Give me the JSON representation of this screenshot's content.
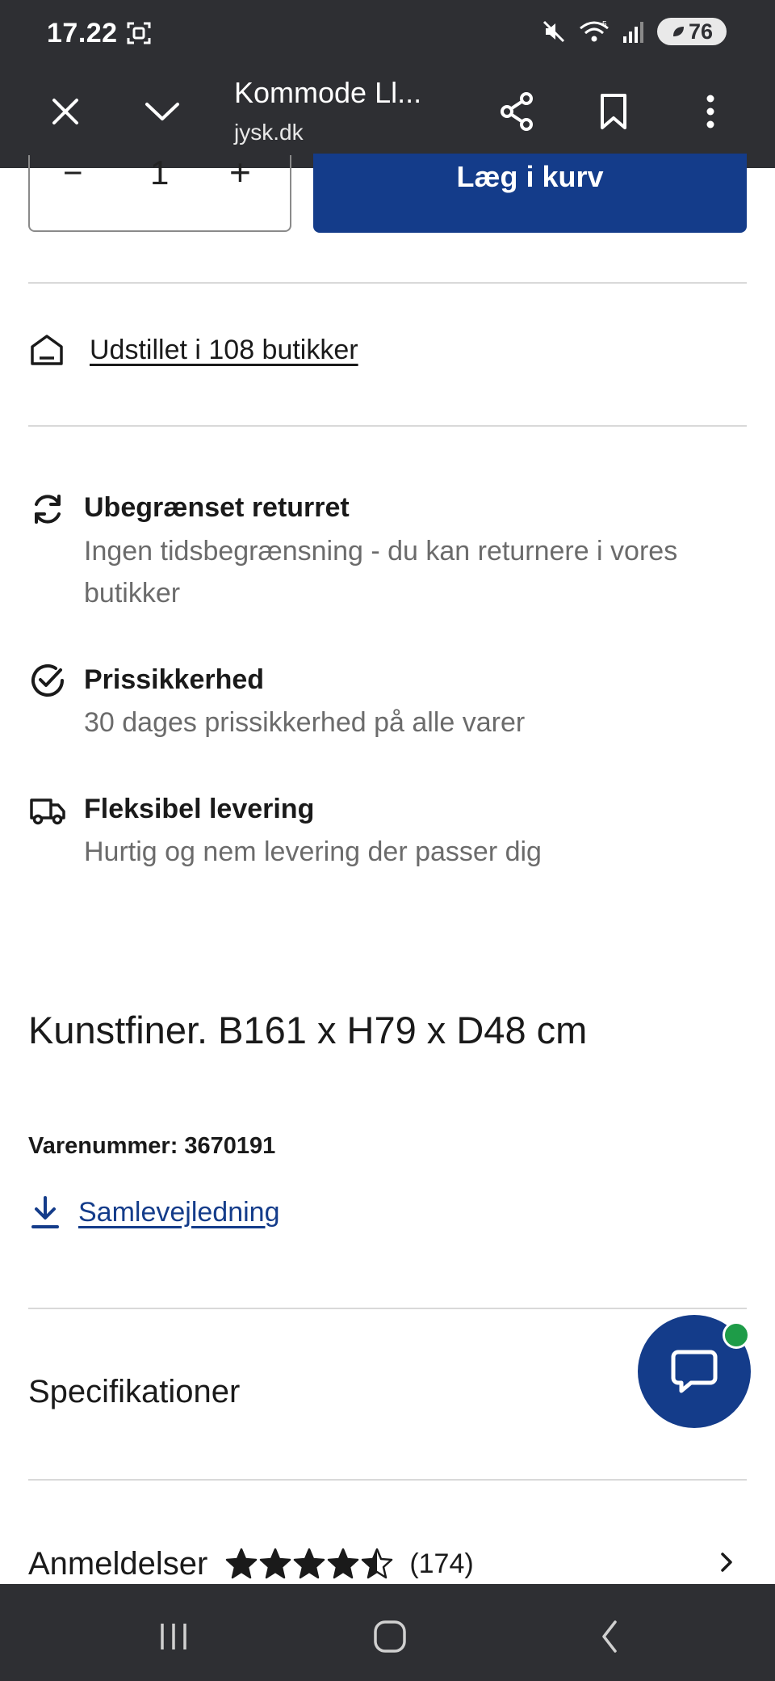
{
  "status_bar": {
    "time": "17.22",
    "network": "5",
    "battery": "76"
  },
  "browser_header": {
    "title": "Kommode Ll...",
    "domain": "jysk.dk"
  },
  "quantity": {
    "minus": "−",
    "value": "1",
    "plus": "+"
  },
  "add_to_cart_label": "Læg i kurv",
  "store_availability": "Udstillet i 108 butikker",
  "usps": [
    {
      "title": "Ubegrænset returret",
      "desc": "Ingen tidsbegrænsning - du kan returnere i vores butikker"
    },
    {
      "title": "Prissikkerhed",
      "desc": "30 dages prissikkerhed på alle varer"
    },
    {
      "title": "Fleksibel levering",
      "desc": "Hurtig og nem levering der passer dig"
    }
  ],
  "product": {
    "description": "Kunstfiner. B161 x H79 x D48 cm",
    "item_number": "Varenummer: 3670191",
    "assembly_link": "Samlevejledning"
  },
  "specifications_label": "Specifikationer",
  "reviews": {
    "label": "Anmeldelser",
    "rating": 4.5,
    "count": "(174)"
  },
  "colors": {
    "header_bg": "#2e2f33",
    "accent": "#143c8a",
    "online_dot": "#1e9c48",
    "muted_text": "#6b6b6b"
  }
}
